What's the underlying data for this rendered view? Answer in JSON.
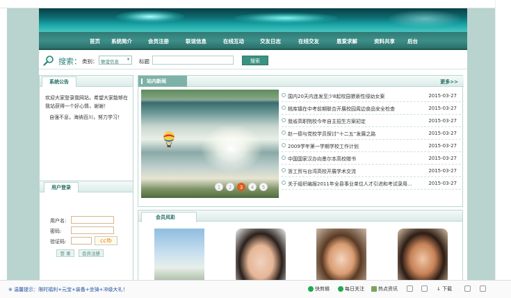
{
  "nav": {
    "items": [
      "首页",
      "系统简介",
      "会员注册",
      "联谊信息",
      "在线互动",
      "交友日志",
      "在线交友",
      "恩爱求解",
      "资料共享",
      "后台"
    ]
  },
  "search": {
    "title": "搜索：",
    "category_label": "类别：",
    "category_value": "联谊信息",
    "keyword_label": "标题",
    "button": "搜索"
  },
  "notice": {
    "title": "系统公告",
    "lines": [
      "欢迎大家登录我网站，希望大家能够在我站获得一个好心情，谢谢！",
      "自强不息，海纳百川，努力学习！"
    ]
  },
  "login": {
    "title": "用户登录",
    "username_label": "用户名:",
    "password_label": "密码:",
    "captcha_label": "验证码:",
    "captcha_text": "ccfb",
    "login_button": "登 录",
    "register_button": "会员注册"
  },
  "news": {
    "title": "站内新闻",
    "more": "更多>>",
    "pager": [
      "1",
      "2",
      "3",
      "4",
      "5"
    ],
    "active_page": "3",
    "items": [
      {
        "title": "国内20天内连发至少8起校园猥亵性侵幼女案",
        "date": "2015-03-27"
      },
      {
        "title": "桃库镇在中考前期联合开展校园周边食品安全检查",
        "date": "2015-03-27"
      },
      {
        "title": "我省高职院校今年自主招生方案初定",
        "date": "2015-03-27"
      },
      {
        "title": "赵一德与党校学员探讨“十二五”发展之路",
        "date": "2015-03-27"
      },
      {
        "title": "2009学年第一学期学校工作计划",
        "date": "2015-03-27"
      },
      {
        "title": "中国国家汉办向墨尔本高校赠书",
        "date": "2015-03-27"
      },
      {
        "title": "浙工贸与台湾高校开展学术交流",
        "date": "2015-03-27"
      },
      {
        "title": "关于组织编报2011年全县事业单位人才引进和考试录用...",
        "date": "2015-03-27"
      }
    ]
  },
  "members": {
    "title": "会员风彩"
  },
  "statusbar": {
    "tip": "※ 温馨提示：限时福利+元宝+装备+坐骑+冲级大礼！",
    "items": [
      "快剪辑",
      "每日关注",
      "热点资讯",
      "下载"
    ]
  },
  "colors": {
    "accent": "#3a9281",
    "background_strip": "#b9d3cf",
    "active_pager": "#e15a1a"
  }
}
